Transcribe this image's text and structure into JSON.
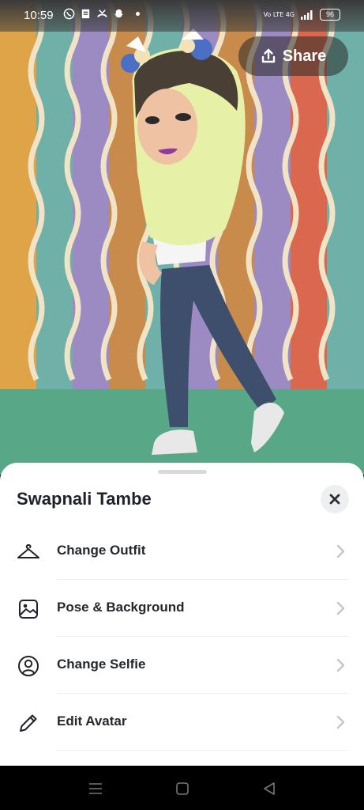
{
  "status_bar": {
    "time": "10:59",
    "icons": [
      "whatsapp-icon",
      "notes-icon",
      "missed-call-icon",
      "snapchat-icon",
      "notification-dot"
    ],
    "network": "Vo LTE 4G",
    "battery": "96"
  },
  "share": {
    "label": "Share",
    "icon": "upload-icon"
  },
  "sheet": {
    "title": "Swapnali Tambe",
    "items": [
      {
        "label": "Change Outfit",
        "icon": "hanger-icon"
      },
      {
        "label": "Pose & Background",
        "icon": "image-frame-icon"
      },
      {
        "label": "Change Selfie",
        "icon": "user-circle-icon"
      },
      {
        "label": "Edit Avatar",
        "icon": "pencil-icon"
      }
    ]
  },
  "nav": [
    "menu-button",
    "home-button",
    "back-button"
  ],
  "colors": {
    "floor": "#58a887",
    "stripe_orange": "#e0a448",
    "stripe_teal": "#6fb1a8",
    "stripe_purple": "#9b8bc2",
    "stripe_red": "#d9684f",
    "wave_cream": "#f1e4c6"
  }
}
